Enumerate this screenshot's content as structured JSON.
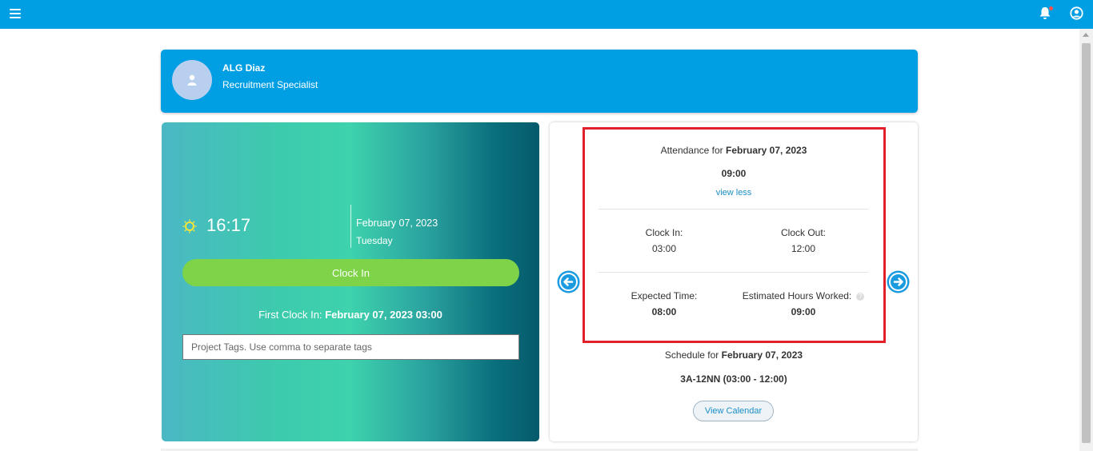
{
  "header": {
    "menu_icon": "hamburger-menu-icon",
    "notification_icon": "bell-icon",
    "account_icon": "user-circle-icon",
    "accent": "#009fe3"
  },
  "profile": {
    "name": "ALG Diaz",
    "title": "Recruitment Specialist",
    "avatar_icon": "user-avatar-icon"
  },
  "clock": {
    "time": "16:17",
    "date": "February 07, 2023",
    "day": "Tuesday",
    "clock_in_label": "Clock In",
    "first_clock_in_label": "First Clock In:",
    "first_clock_in_value": "February 07, 2023 03:00",
    "tags_placeholder": "Project Tags. Use comma to separate tags",
    "button_color": "#7ed348"
  },
  "attendance": {
    "title_prefix": "Attendance for",
    "date": "February 07, 2023",
    "hours": "09:00",
    "view_less": "view less",
    "clock_in_label": "Clock In:",
    "clock_in_value": "03:00",
    "clock_out_label": "Clock Out:",
    "clock_out_value": "12:00",
    "expected_label": "Expected Time:",
    "expected_value": "08:00",
    "estimated_label": "Estimated Hours Worked:",
    "estimated_value": "09:00",
    "help_symbol": "?",
    "highlight_color": "#e2202a"
  },
  "schedule": {
    "title_prefix": "Schedule for",
    "date": "February 07, 2023",
    "shift": "3A-12NN (03:00 - 12:00)",
    "view_calendar_label": "View Calendar"
  }
}
